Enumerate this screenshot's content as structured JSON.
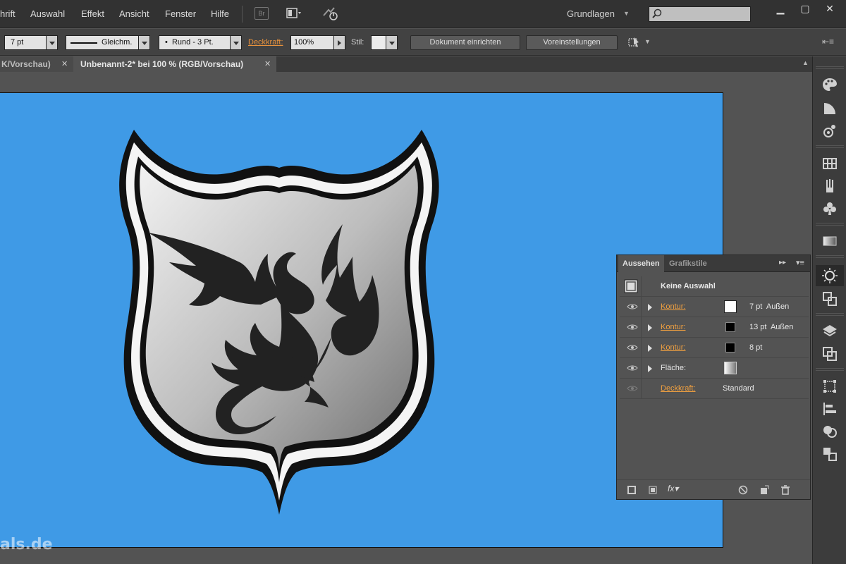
{
  "menubar": {
    "items": [
      "hrift",
      "Auswahl",
      "Effekt",
      "Ansicht",
      "Fenster",
      "Hilfe"
    ],
    "bridge_label": "Br",
    "workspace": "Grundlagen",
    "search_placeholder": ""
  },
  "controlbar": {
    "stroke_weight": "7 pt",
    "profile": "Gleichm.",
    "brush": "Rund - 3 Pt.",
    "opacity_label": "Deckkraft:",
    "opacity_value": "100%",
    "style_label": "Stil:",
    "doc_setup_button": "Dokument einrichten",
    "preferences_button": "Voreinstellungen"
  },
  "tabs": [
    {
      "label": "K/Vorschau)",
      "active": false
    },
    {
      "label": "Unbenannt-2* bei 100 % (RGB/Vorschau)",
      "active": true
    }
  ],
  "canvas": {
    "background": "#3f9ae6",
    "watermark": "als.de"
  },
  "appearance_panel": {
    "tabs": [
      "Aussehen",
      "Grafikstile"
    ],
    "selection": "Keine Auswahl",
    "rows": [
      {
        "label": "Kontur:",
        "link": true,
        "swatch": "#ffffff",
        "value": "7 pt  Außen"
      },
      {
        "label": "Kontur:",
        "link": true,
        "swatch": "#000000",
        "value": "13 pt  Außen"
      },
      {
        "label": "Kontur:",
        "link": true,
        "swatch": "#000000",
        "value": "8 pt"
      },
      {
        "label": "Fläche:",
        "link": false,
        "swatch": "gradient",
        "value": ""
      },
      {
        "label": "Deckkraft:",
        "link": true,
        "swatch": "",
        "value": "Standard"
      }
    ]
  },
  "colors": {
    "accent_orange": "#e8923d",
    "canvas_blue": "#3f9ae6"
  }
}
